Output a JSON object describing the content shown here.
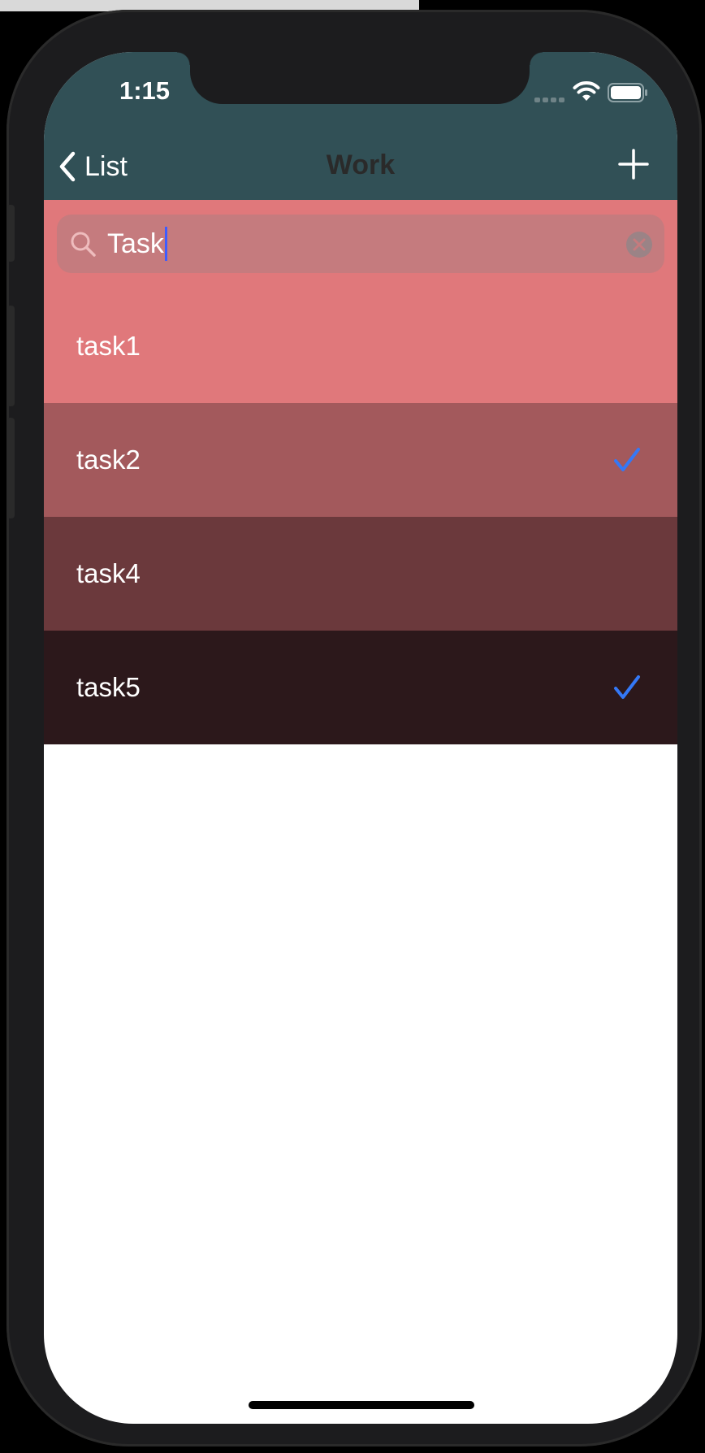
{
  "status_bar": {
    "time": "1:15"
  },
  "nav": {
    "back_label": "List",
    "title": "Work"
  },
  "search": {
    "value": "Task"
  },
  "tasks": [
    {
      "label": "task1",
      "checked": false,
      "bg": "#e0787b"
    },
    {
      "label": "task2",
      "checked": true,
      "bg": "#a3595c"
    },
    {
      "label": "task4",
      "checked": false,
      "bg": "#6b393c"
    },
    {
      "label": "task5",
      "checked": true,
      "bg": "#2c181b"
    }
  ],
  "colors": {
    "header": "#315056",
    "accent_check": "#3478f6"
  }
}
